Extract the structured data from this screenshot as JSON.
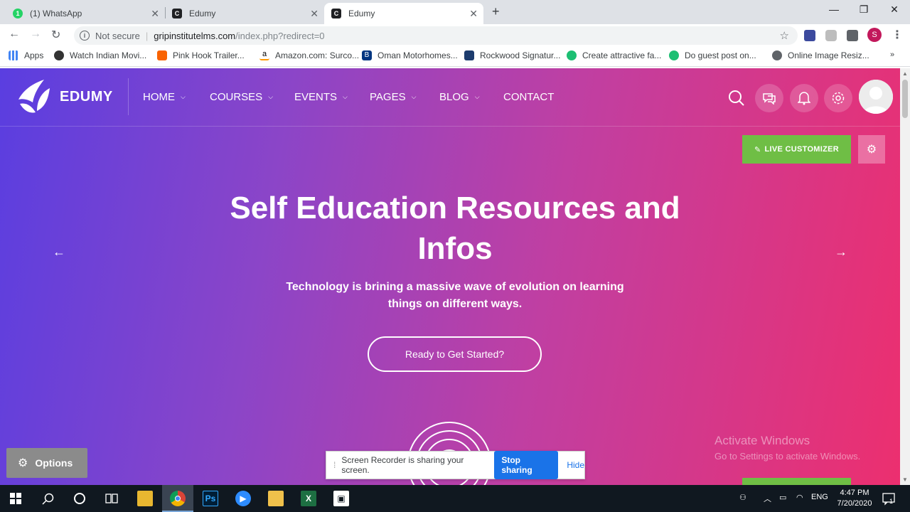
{
  "tabs": [
    {
      "title": "(1) WhatsApp",
      "favicon_color": "#25d366",
      "favicon_icon": "whatsapp-icon"
    },
    {
      "title": "Edumy",
      "favicon_color": "#202124",
      "favicon_icon": "c-favicon-icon"
    },
    {
      "title": "Edumy",
      "favicon_color": "#202124",
      "favicon_icon": "c-favicon-icon",
      "active": true
    }
  ],
  "toolbar": {
    "not_secure": "Not secure",
    "url_host": "gripinstitutelms.com",
    "url_path": "/index.php?redirect=0",
    "profile_initial": "S"
  },
  "bookmarks": [
    {
      "label": "Apps",
      "icon": "apps-grid-icon"
    },
    {
      "label": "Watch Indian Movi...",
      "icon": "film-reel-icon"
    },
    {
      "label": "Pink Hook Trailer...",
      "icon": "homedepot-icon"
    },
    {
      "label": "Amazon.com: Surco...",
      "icon": "amazon-icon"
    },
    {
      "label": "Oman Motorhomes...",
      "icon": "booking-icon"
    },
    {
      "label": "Rockwood Signatur...",
      "icon": "mountain-icon"
    },
    {
      "label": "Create attractive fa...",
      "icon": "fiverr-icon"
    },
    {
      "label": "Do guest post on...",
      "icon": "fiverr-icon"
    },
    {
      "label": "Online Image Resiz...",
      "icon": "globe-icon"
    }
  ],
  "site": {
    "logo_text": "EDUMY",
    "menu": [
      "HOME",
      "COURSES",
      "EVENTS",
      "PAGES",
      "BLOG",
      "CONTACT"
    ],
    "live_customizer": "LIVE CUSTOMIZER",
    "hero_title_line1": "Self Education Resources and",
    "hero_title_line2": "Infos",
    "hero_subtitle_line1": "Technology is brining a massive wave of evolution on learning",
    "hero_subtitle_line2": "things on different ways.",
    "cta": "Ready to Get Started?",
    "options": "Options"
  },
  "watermark": {
    "line1": "Activate Windows",
    "line2": "Go to Settings to activate Windows."
  },
  "share_bar": {
    "message": "Screen Recorder is sharing your screen.",
    "stop": "Stop sharing",
    "hide": "Hide"
  },
  "taskbar": {
    "lang": "ENG",
    "time": "4:47 PM",
    "date": "7/20/2020",
    "notification_count": "1"
  },
  "colors": {
    "gradient_start": "#5a3ee0",
    "gradient_end": "#ec2f6f",
    "live_customizer_green": "#6fbe45",
    "stop_sharing_blue": "#1a73e8"
  }
}
